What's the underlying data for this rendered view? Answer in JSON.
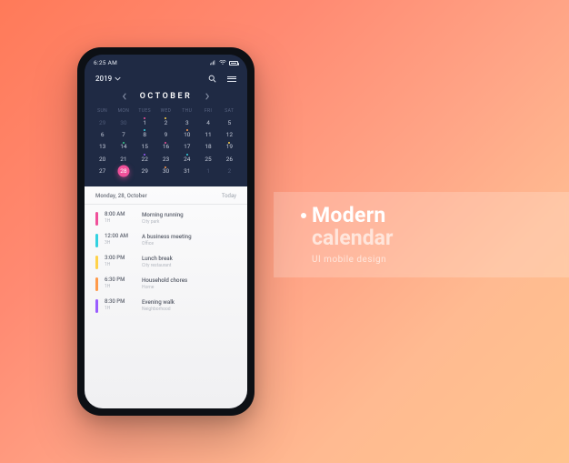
{
  "promo": {
    "title_top": "Modern",
    "title_bottom": "calendar",
    "subtitle": "UI mobile design"
  },
  "statusbar": {
    "time": "6:25 AM"
  },
  "appbar": {
    "year": "2019"
  },
  "month": {
    "name": "OCTOBER"
  },
  "dow": [
    "SUN",
    "MON",
    "TUES",
    "WED",
    "THU",
    "FRI",
    "SAT"
  ],
  "weeks": [
    [
      {
        "n": "29",
        "dim": true
      },
      {
        "n": "30",
        "dim": true
      },
      {
        "n": "1",
        "dot": "pink"
      },
      {
        "n": "2",
        "dot": "yellow"
      },
      {
        "n": "3"
      },
      {
        "n": "4"
      },
      {
        "n": "5"
      }
    ],
    [
      {
        "n": "6"
      },
      {
        "n": "7"
      },
      {
        "n": "8",
        "dot": "cyan"
      },
      {
        "n": "9"
      },
      {
        "n": "10",
        "dot": "orange"
      },
      {
        "n": "11"
      },
      {
        "n": "12"
      }
    ],
    [
      {
        "n": "13"
      },
      {
        "n": "14",
        "dot": "green"
      },
      {
        "n": "15"
      },
      {
        "n": "16",
        "dot": "pink"
      },
      {
        "n": "17"
      },
      {
        "n": "18"
      },
      {
        "n": "19",
        "dot": "yellow"
      }
    ],
    [
      {
        "n": "20"
      },
      {
        "n": "21"
      },
      {
        "n": "22",
        "dot": "purple"
      },
      {
        "n": "23"
      },
      {
        "n": "24",
        "dot": "cyan"
      },
      {
        "n": "25"
      },
      {
        "n": "26"
      }
    ],
    [
      {
        "n": "27"
      },
      {
        "n": "28",
        "sel": true
      },
      {
        "n": "29"
      },
      {
        "n": "30",
        "dot": "orange"
      },
      {
        "n": "31"
      },
      {
        "n": "1",
        "dim": true
      },
      {
        "n": "2",
        "dim": true
      }
    ]
  ],
  "agenda": {
    "date_label": "Monday, 28, October",
    "today_label": "Today",
    "events": [
      {
        "color": "pink",
        "time": "8:00 AM",
        "dur": "1H",
        "title": "Morning running",
        "loc": "City park"
      },
      {
        "color": "cyan",
        "time": "12:00 AM",
        "dur": "3H",
        "title": "A business meeting",
        "loc": "Office"
      },
      {
        "color": "yellow",
        "time": "3:00 PM",
        "dur": "1H",
        "title": "Lunch break",
        "loc": "City restaurant"
      },
      {
        "color": "orange",
        "time": "6:30 PM",
        "dur": "1H",
        "title": "Household chores",
        "loc": "Home"
      },
      {
        "color": "purple",
        "time": "8:30 PM",
        "dur": "1H",
        "title": "Evening walk",
        "loc": "Neighborhood"
      }
    ]
  }
}
